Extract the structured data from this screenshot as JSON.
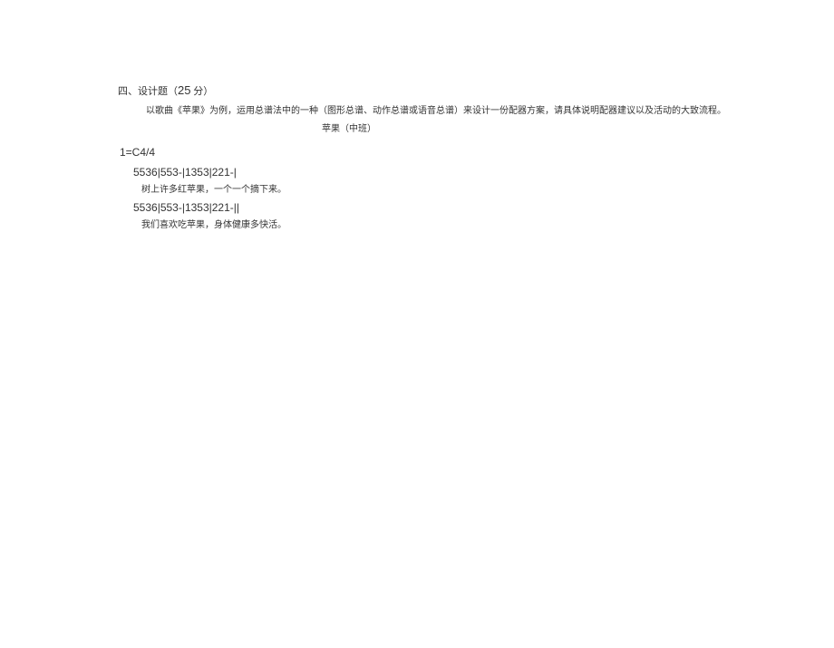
{
  "section": {
    "heading_prefix": "四、设计题（",
    "points": "25",
    "heading_suffix": " 分）"
  },
  "question": {
    "text": "以歌曲《苹果》为例，运用总谱法中的一种（图形总谱、动作总谱或语音总谱）来设计一份配器方案，请具体说明配器建议以及活动的大致流程。"
  },
  "song": {
    "title": "苹果（中班）",
    "key_signature": "1=C4/4",
    "line1": {
      "notation": "5536|553-|1353|221-|",
      "lyrics": "树上许多红苹果，一个一个摘下来。"
    },
    "line2": {
      "notation": "5536|553-|1353|221-||",
      "lyrics": "我们喜欢吃苹果，身体健康多快活。"
    }
  }
}
